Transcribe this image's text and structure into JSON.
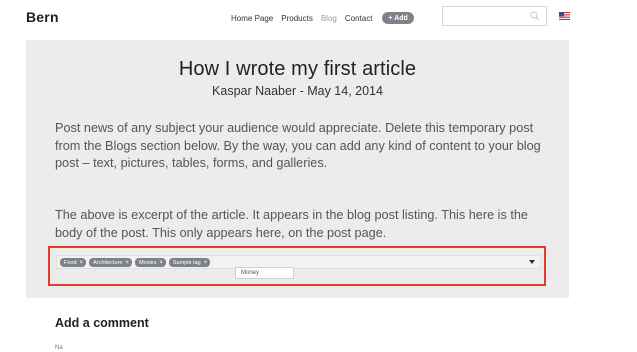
{
  "header": {
    "brand": "Bern",
    "nav": [
      "Home Page",
      "Products",
      "Blog",
      "Contact"
    ],
    "active_nav": "Blog",
    "add_label": "+ Add",
    "search": {
      "placeholder": "",
      "value": ""
    }
  },
  "article": {
    "title": "How I wrote my first article",
    "byline": "Kaspar Naaber - May 14, 2014",
    "paragraphs": [
      "Post news of any subject your audience would appreciate. Delete this temporary post from the Blogs section below. By the way, you can add any kind of content to your blog post – text, pictures, tables, forms, and galleries.",
      "The above is excerpt of the article. It appears in the blog post listing. This here is the body of the post. This only appears here, on the post page."
    ]
  },
  "tags": {
    "items": [
      "Food",
      "Architecture",
      "Movies",
      "Sample tag"
    ],
    "remove_glyph": "×",
    "suggestion": "Money"
  },
  "comments": {
    "heading": "Add a comment",
    "cut_label": "Na"
  },
  "colors": {
    "panel_bg": "#ececec",
    "highlight_border": "#e33b2e",
    "tag_bg": "#7d8289"
  }
}
